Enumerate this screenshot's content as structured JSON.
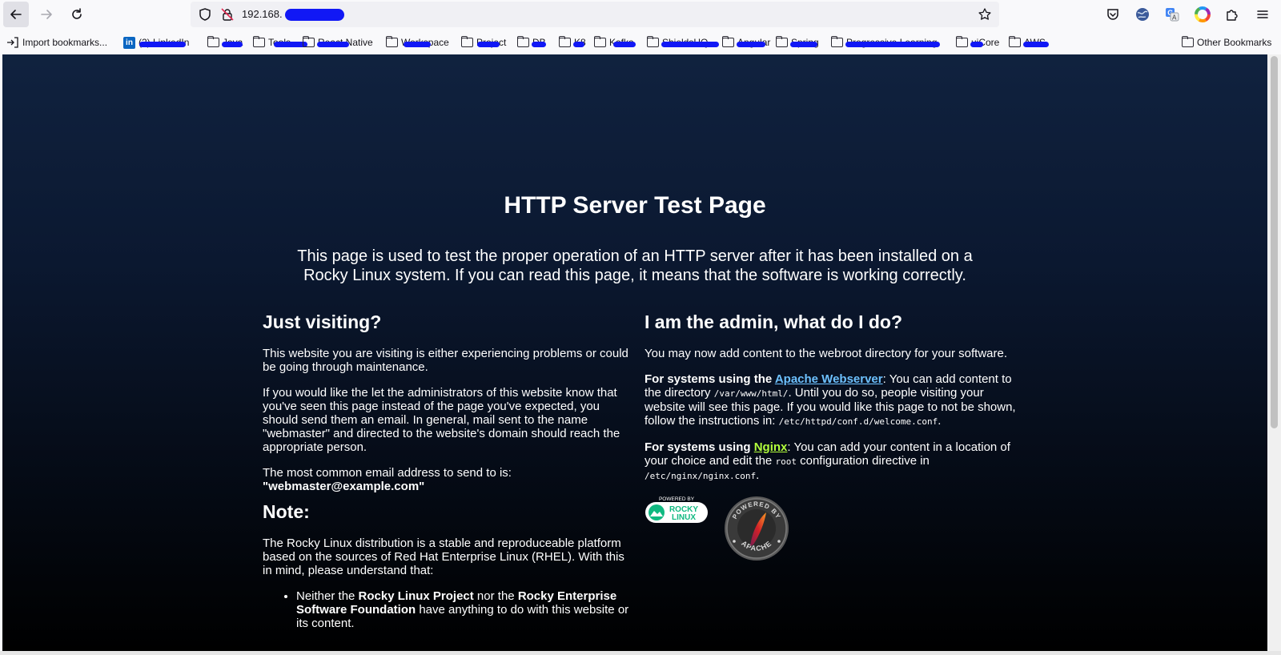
{
  "browser": {
    "url": "192.168.",
    "icons": [
      "back-arrow-icon",
      "forward-arrow-icon",
      "reload-icon",
      "shield-icon",
      "insecure-lock-icon",
      "bookmark-star-icon",
      "pocket-icon",
      "globe-extension-icon",
      "translate-icon",
      "color-wheel-icon",
      "extensions-puzzle-icon",
      "hamburger-menu-icon"
    ]
  },
  "bookmarks": {
    "import_label": "Import bookmarks...",
    "items": [
      {
        "label": "(2) LinkedIn",
        "kind": "linkedin"
      },
      {
        "label": "Java"
      },
      {
        "label": "Tools"
      },
      {
        "label": "React Native"
      },
      {
        "label": "Workspace"
      },
      {
        "label": "Project"
      },
      {
        "label": "DB"
      },
      {
        "label": "K8"
      },
      {
        "label": "Kafka"
      },
      {
        "label": "ShieldsHQ"
      },
      {
        "label": "Angular"
      },
      {
        "label": "Spring"
      },
      {
        "label": "Progressive Learning"
      },
      {
        "label": "uiCore"
      },
      {
        "label": "AWS"
      }
    ],
    "other_label": "Other Bookmarks"
  },
  "page": {
    "title": "HTTP Server Test Page",
    "intro": "This page is used to test the proper operation of an HTTP server after it has been installed on a Rocky Linux system. If you can read this page, it means that the software is working correctly.",
    "left": {
      "heading": "Just visiting?",
      "p1": "This website you are visiting is either experiencing problems or could be going through maintenance.",
      "p2": "If you would like the let the administrators of this website know that you've seen this page instead of the page you've expected, you should send them an email. In general, mail sent to the name \"webmaster\" and directed to the website's domain should reach the appropriate person.",
      "p3_text": "The most common email address to send to is:",
      "p3_email": "\"webmaster@example.com\"",
      "note_heading": "Note:",
      "note_p": "The Rocky Linux distribution is a stable and reproduceable platform based on the sources of Red Hat Enterprise Linux (RHEL). With this in mind, please understand that:",
      "bullet_pre": "Neither the ",
      "bullet_b1": "Rocky Linux Project",
      "bullet_mid": " nor the ",
      "bullet_b2": "Rocky Enterprise Software Foundation",
      "bullet_post": " have anything to do with this website or its content."
    },
    "right": {
      "heading": "I am the admin, what do I do?",
      "p1": "You may now add content to the webroot directory for your software.",
      "apache_pre": "For systems using the ",
      "apache_link": "Apache Webserver",
      "apache_t1": ": You can add content to the directory ",
      "apache_dir": "/var/www/html/",
      "apache_t2": ". Until you do so, people visiting your website will see this page. If you would like this page to not be shown, follow the instructions in: ",
      "apache_conf": "/etc/httpd/conf.d/welcome.conf",
      "apache_end": ".",
      "nginx_pre": "For systems using ",
      "nginx_link": "Nginx",
      "nginx_t1": ": You can add your content in a location of your choice and edit the ",
      "nginx_root": "root",
      "nginx_t2": " configuration directive in ",
      "nginx_conf": "/etc/nginx/nginx.conf",
      "nginx_end": "."
    },
    "logos": {
      "rocky_top": "POWERED BY",
      "rocky_main1": "ROCKY",
      "rocky_main2": "LINUX",
      "apache_top": "POWERED BY",
      "apache_bottom": "APACHE"
    }
  }
}
